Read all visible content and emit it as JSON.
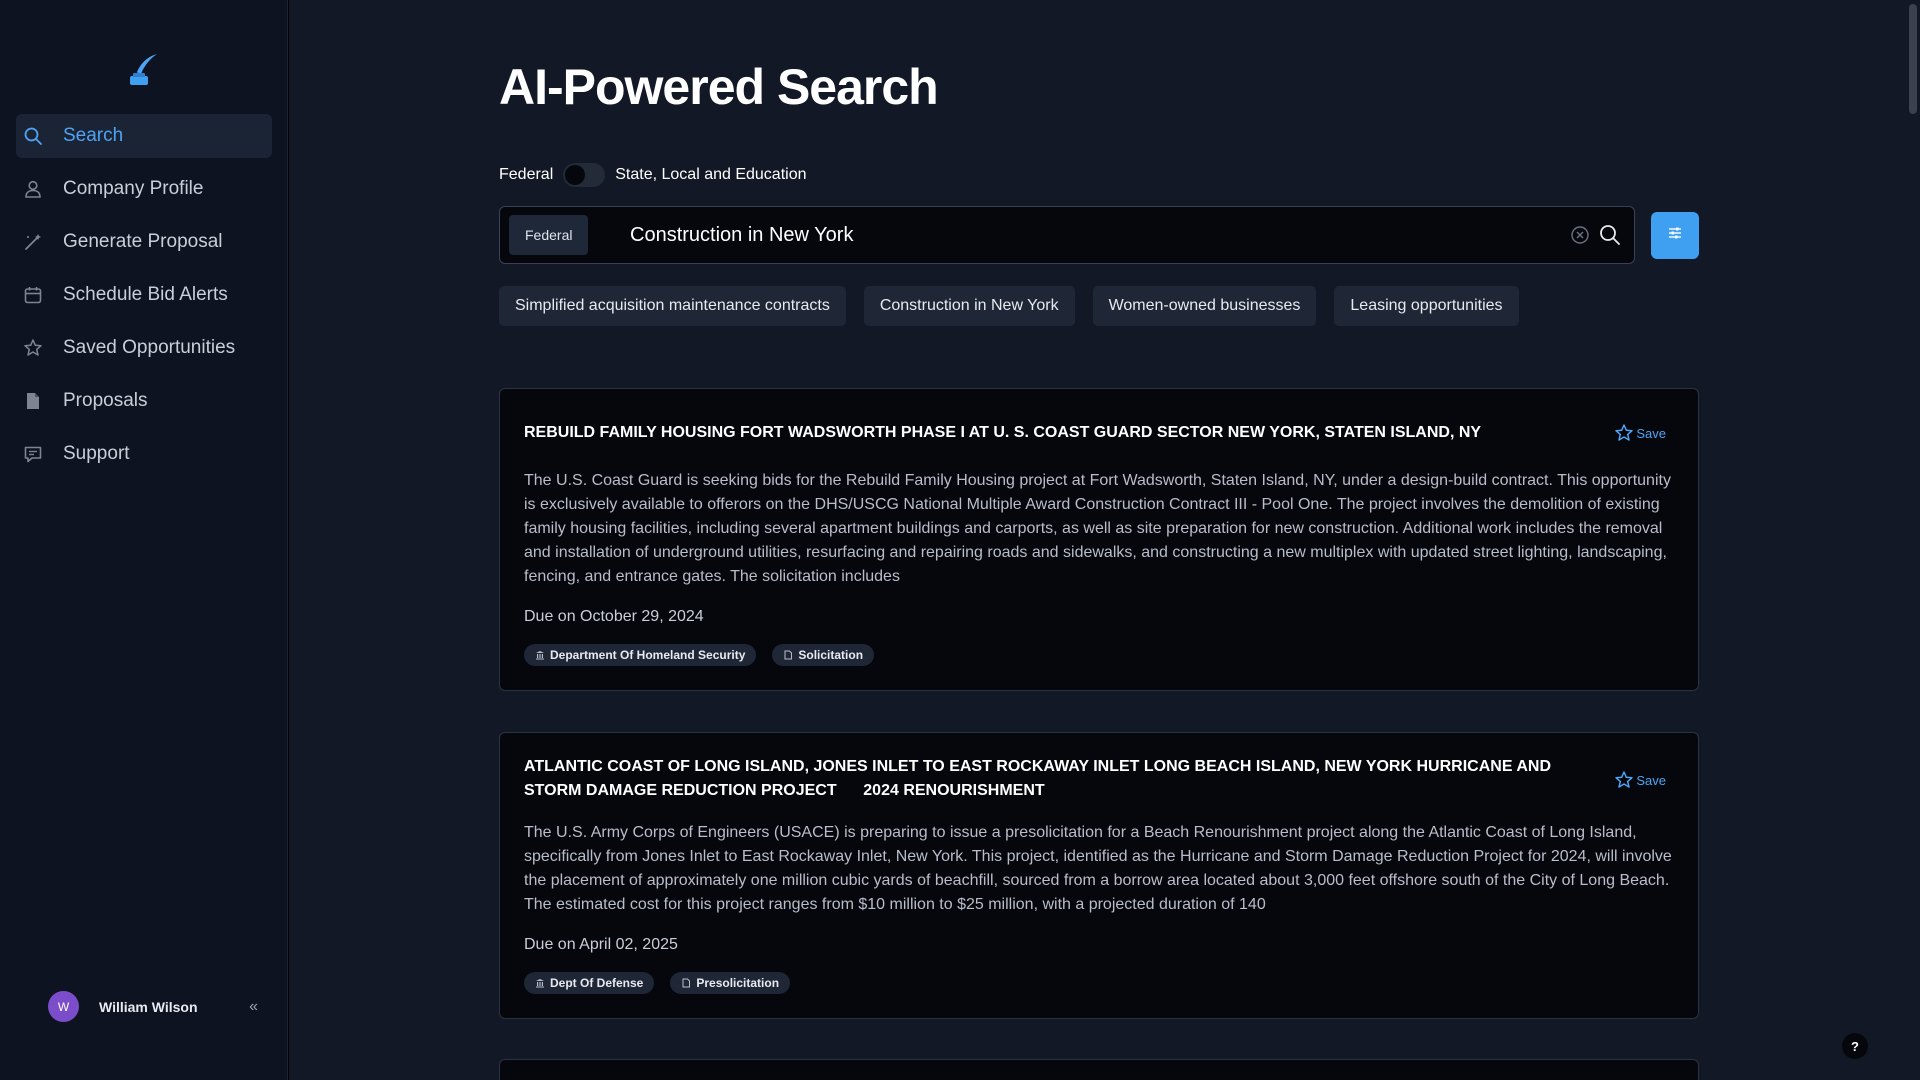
{
  "sidebar": {
    "logo_icon": "quill-ink-icon",
    "items": [
      {
        "label": "Search",
        "icon": "search-icon",
        "active": true
      },
      {
        "label": "Company Profile",
        "icon": "user-icon"
      },
      {
        "label": "Generate Proposal",
        "icon": "magic-wand-icon"
      },
      {
        "label": "Schedule Bid Alerts",
        "icon": "calendar-icon"
      },
      {
        "label": "Saved Opportunities",
        "icon": "star-icon"
      },
      {
        "label": "Proposals",
        "icon": "document-icon"
      },
      {
        "label": "Support",
        "icon": "chat-icon"
      }
    ],
    "user": {
      "initial": "W",
      "name": "William Wilson",
      "collapse_glyph": "«"
    }
  },
  "main": {
    "title": "AI-Powered Search",
    "toggle": {
      "left_label": "Federal",
      "right_label": "State, Local and Education",
      "on": false
    },
    "search": {
      "scope": "Federal",
      "value": "Construction in New York"
    },
    "suggestions": [
      "Simplified acquisition maintenance contracts",
      "Construction in New York",
      "Women-owned businesses",
      "Leasing opportunities"
    ],
    "results": [
      {
        "title": "REBUILD FAMILY HOUSING FORT WADSWORTH PHASE I AT U. S. COAST GUARD SECTOR NEW YORK, STATEN ISLAND, NY",
        "save_label": "Save",
        "description": "The U.S. Coast Guard is seeking bids for the Rebuild Family Housing project at Fort Wadsworth, Staten Island, NY, under a design-build contract. This opportunity is exclusively available to offerors on the DHS/USCG National Multiple Award Construction Contract III - Pool One. The project involves the demolition of existing family housing facilities, including several apartment buildings and carports, as well as site preparation for new construction. Additional work includes the removal and installation of underground utilities, resurfacing and repairing roads and sidewalks, and constructing a new multiplex with updated street lighting, landscaping, fencing, and entrance gates. The solicitation includes",
        "due": "Due on October 29, 2024",
        "agency": "Department Of Homeland Security",
        "type": "Solicitation"
      },
      {
        "title": "ATLANTIC COAST OF LONG ISLAND, JONES INLET TO EAST ROCKAWAY INLET LONG BEACH ISLAND, NEW YORK HURRICANE AND STORM DAMAGE REDUCTION PROJECT      2024 RENOURISHMENT",
        "save_label": "Save",
        "description": "The U.S. Army Corps of Engineers (USACE) is preparing to issue a presolicitation for a Beach Renourishment project along the Atlantic Coast of Long Island, specifically from Jones Inlet to East Rockaway Inlet, New York. This project, identified as the Hurricane and Storm Damage Reduction Project for 2024, will involve the placement of approximately one million cubic yards of beachfill, sourced from a borrow area located about 3,000 feet offshore south of the City of Long Beach. The estimated cost for this project ranges from $10 million to $25 million, with a projected duration of 140",
        "due": "Due on April 02, 2025",
        "agency": "Dept Of Defense",
        "type": "Presolicitation"
      }
    ],
    "help_label": "?"
  },
  "colors": {
    "accent": "#4ea3f5",
    "filter_button": "#3f9ff0",
    "sidebar_bg": "#0d1320",
    "main_bg": "#121826",
    "card_bg": "#05070c",
    "avatar": "#7c4dca"
  }
}
